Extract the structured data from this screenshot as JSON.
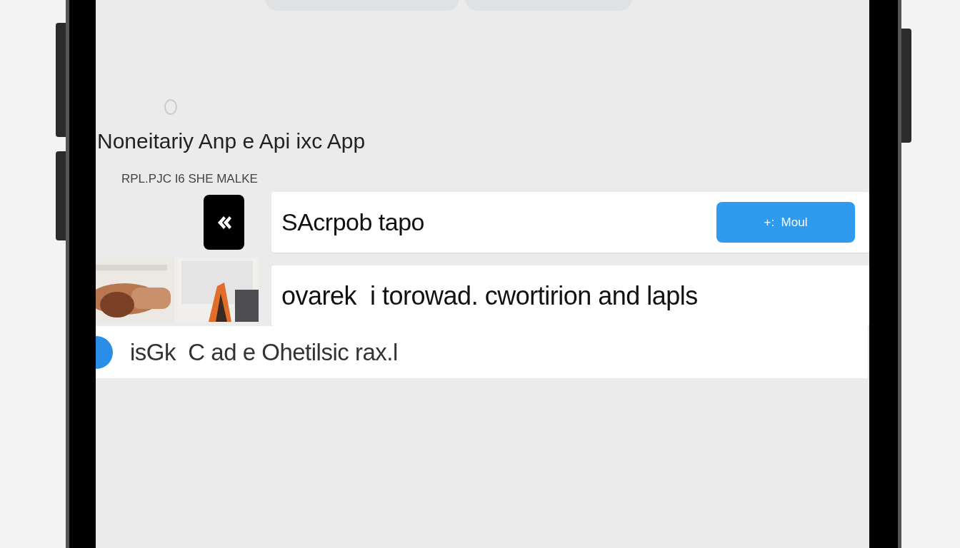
{
  "header": {
    "title": "Noneitariy Anp e Api ixc App",
    "subtitle": "RPL.PJC I6 SHE MALKE"
  },
  "rows": [
    {
      "kind": "app",
      "text": "SAcrpob tapo",
      "button": "+:  Moul"
    },
    {
      "kind": "picture",
      "text": "ovarek  i torowad. cwortirion and lapls"
    },
    {
      "kind": "dot",
      "text": "isGk  C ad e Ohetilsic rax.l"
    }
  ]
}
